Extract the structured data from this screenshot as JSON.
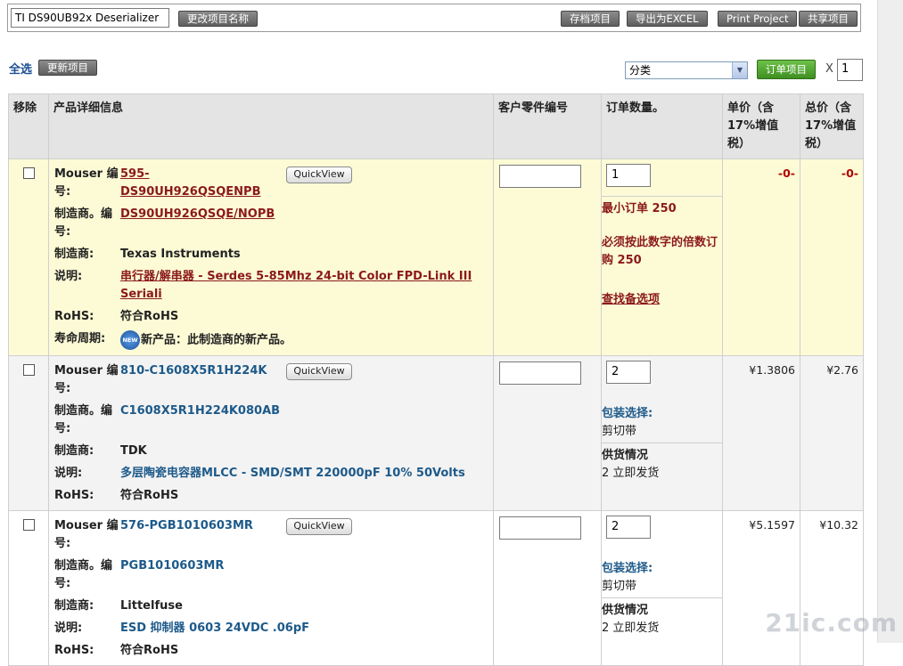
{
  "project": {
    "name_value": "TI DS90UB92x Deserializer",
    "rename_label": "更改项目名称",
    "archive_label": "存档项目",
    "export_label": "导出为EXCEL",
    "print_label": "Print Project",
    "share_label": "共享项目"
  },
  "toolbar": {
    "select_all": "全选",
    "update_label": "更新项目",
    "category_value": "分类",
    "order_label": "订单项目",
    "times": "X",
    "qty_value": "1"
  },
  "table": {
    "headers": {
      "remove": "移除",
      "details": "产品详细信息",
      "customer_part": "客户零件编号",
      "order_qty": "订单数量。",
      "unit_price": "单价（含17%增值税）",
      "total_price": "总价（含17%增值税）"
    },
    "labels": {
      "mouser_no": "Mouser 编号:",
      "mfr_no": "制造商。编号:",
      "mfr": "制造商:",
      "desc": "说明:",
      "rohs": "RoHS:",
      "lifecycle": "寿命周期:",
      "quickview": "QuickView",
      "new_badge": "NEW"
    },
    "rows": [
      {
        "mouser_no": "595-DS90UH926QSQENPB",
        "mfr_no": "DS90UH926QSQE/NOPB",
        "mfr": "Texas Instruments",
        "desc": "串行器/解串器 - Serdes 5-85Mhz 24-bit Color FPD-Link III Seriali",
        "rohs": "符合RoHS",
        "lifecycle": "新产品：此制造商的新产品。",
        "qty": "1",
        "note1": "最小订单 250",
        "note2": "必须按此数字的倍数订购 250",
        "note3": "查找备选项",
        "unit_price": "-0-",
        "total_price": "-0-"
      },
      {
        "mouser_no": "810-C1608X5R1H224K",
        "mfr_no": "C1608X5R1H224K080AB",
        "mfr": "TDK",
        "desc": "多层陶瓷电容器MLCC - SMD/SMT 220000pF 10% 50Volts",
        "rohs": "符合RoHS",
        "qty": "2",
        "pack_label": "包装选择:",
        "pack_value": "剪切带",
        "supply_label": "供货情况",
        "supply_value": "2 立即发货",
        "unit_price": "¥1.3806",
        "total_price": "¥2.76"
      },
      {
        "mouser_no": "576-PGB1010603MR",
        "mfr_no": "PGB1010603MR",
        "mfr": "Littelfuse",
        "desc": "ESD 抑制器 0603 24VDC .06pF",
        "rohs": "符合RoHS",
        "qty": "2",
        "pack_label": "包装选择:",
        "pack_value": "剪切带",
        "supply_label": "供货情况",
        "supply_value": "2 立即发货",
        "unit_price": "¥5.1597",
        "total_price": "¥10.32"
      }
    ]
  },
  "watermark": "21ic.com"
}
